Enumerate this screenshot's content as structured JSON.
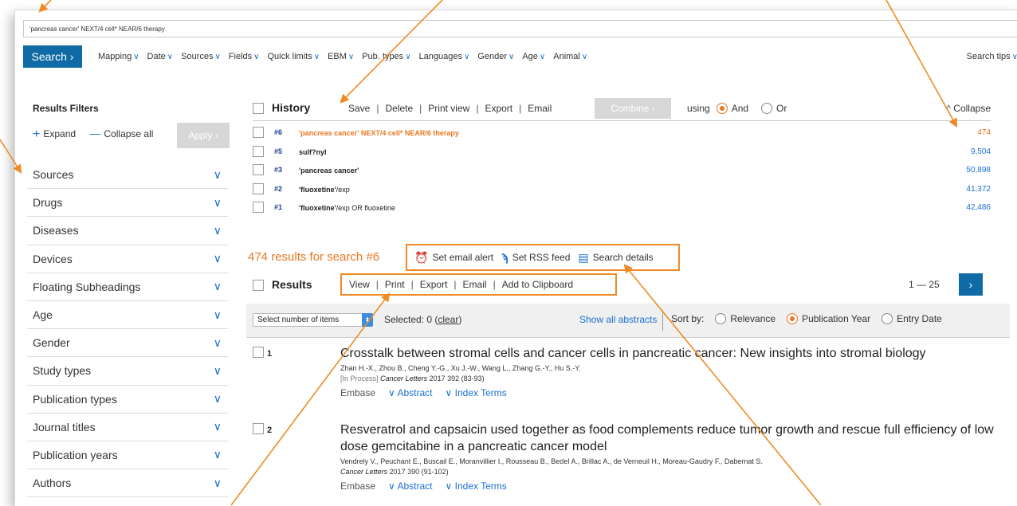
{
  "query": "'pancreas cancer' NEXT/4 cell* NEAR/6 therapy",
  "toolbar": {
    "search_label": "Search",
    "menu": [
      "Mapping",
      "Date",
      "Sources",
      "Fields",
      "Quick limits",
      "EBM",
      "Pub. types",
      "Languages",
      "Gender",
      "Age",
      "Animal"
    ],
    "search_tips": "Search tips"
  },
  "sidebar": {
    "title": "Results Filters",
    "expand": "Expand",
    "collapse_all": "Collapse all",
    "apply": "Apply",
    "filters": [
      "Sources",
      "Drugs",
      "Diseases",
      "Devices",
      "Floating Subheadings",
      "Age",
      "Gender",
      "Study types",
      "Publication types",
      "Journal titles",
      "Publication years",
      "Authors"
    ]
  },
  "history": {
    "title": "History",
    "actions": [
      "Save",
      "Delete",
      "Print view",
      "Export",
      "Email"
    ],
    "combine": "Combine",
    "using": "using",
    "and": "And",
    "or": "Or",
    "collapse": "Collapse",
    "rows": [
      {
        "num": "#6",
        "q1": "'pancreas cancer' NEXT/4 cell* NEAR/6 therapy",
        "q2": "",
        "count": "474",
        "active": true
      },
      {
        "num": "#5",
        "q1": "sulf?nyl",
        "q2": "",
        "count": "9,504",
        "active": false
      },
      {
        "num": "#3",
        "q1": "'pancreas cancer'",
        "q2": "",
        "count": "50,898",
        "active": false
      },
      {
        "num": "#2",
        "q1": "'fluoxetine'",
        "q2": "/exp",
        "count": "41,372",
        "active": false
      },
      {
        "num": "#1",
        "q1": "'fluoxetine'",
        "q2": "/exp OR fluoxetine",
        "count": "42,486",
        "active": false
      }
    ]
  },
  "results": {
    "summary": "474 results for search #6",
    "alert": "Set email alert",
    "rss": "Set RSS feed",
    "details": "Search details",
    "title": "Results",
    "actions": [
      "View",
      "Print",
      "Export",
      "Email",
      "Add to Clipboard"
    ],
    "pager": "1 — 25",
    "select_items": "Select number of items",
    "selected": "Selected: 0",
    "clear": "clear",
    "show_abstracts": "Show all abstracts",
    "sort_by": "Sort by:",
    "sort_options": [
      "Relevance",
      "Publication Year",
      "Entry Date"
    ],
    "items": [
      {
        "num": "1",
        "title": "Crosstalk between stromal cells and cancer cells in pancreatic cancer: New insights into stromal biology",
        "authors": "Zhan H.-X., Zhou B., Cheng Y.-G., Xu J.-W., Wang L., Zhang G.-Y., Hu S.-Y.",
        "status": "[In Process]",
        "journal": "Cancer Letters",
        "citation": "2017 392 (83-93)",
        "db": "Embase",
        "abstract": "Abstract",
        "index": "Index Terms"
      },
      {
        "num": "2",
        "title": "Resveratrol and capsaicin used together as food complements reduce tumor growth and rescue full efficiency of low dose gemcitabine in a pancreatic cancer model",
        "authors": "Vendrely V., Peuchant E., Buscail E., Moranvillier I., Rousseau B., Bedel A., Brillac A., de Verneuil H., Moreau-Gaudry F., Dabernat S.",
        "status": "",
        "journal": "Cancer Letters",
        "citation": "2017 390 (91-102)",
        "db": "Embase",
        "abstract": "Abstract",
        "index": "Index Terms"
      }
    ]
  },
  "colors": {
    "accent_orange": "#e87722",
    "annotation_orange": "#f08a24",
    "primary_blue": "#0f6aa6",
    "link_blue": "#1a6fd0"
  }
}
